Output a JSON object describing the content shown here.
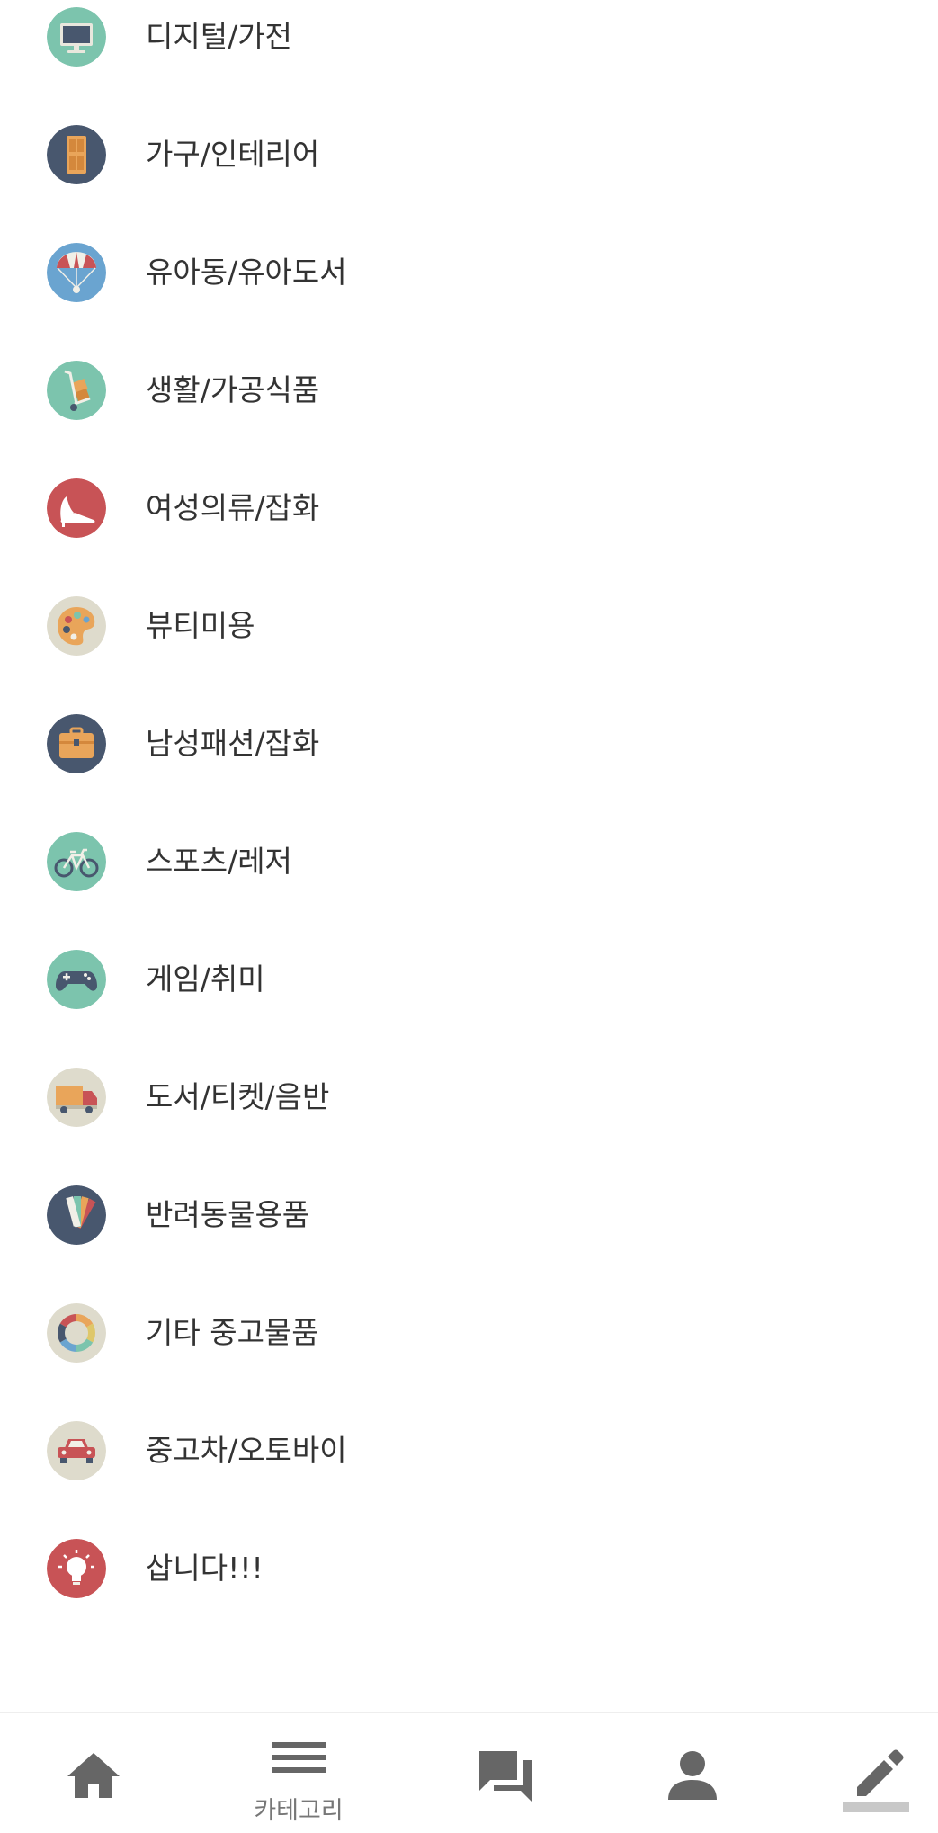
{
  "categories": [
    {
      "label": "디지털/가전",
      "icon": "monitor-icon",
      "color": "#7cc4ad"
    },
    {
      "label": "가구/인테리어",
      "icon": "door-icon",
      "color": "#48576e"
    },
    {
      "label": "유아동/유아도서",
      "icon": "parachute-icon",
      "color": "#6aa4d0"
    },
    {
      "label": "생활/가공식품",
      "icon": "hand-truck-icon",
      "color": "#7cc4ad"
    },
    {
      "label": "여성의류/잡화",
      "icon": "high-heel-icon",
      "color": "#c85356"
    },
    {
      "label": "뷰티미용",
      "icon": "palette-icon",
      "color": "#dedbcc"
    },
    {
      "label": "남성패션/잡화",
      "icon": "briefcase-icon",
      "color": "#48576e"
    },
    {
      "label": "스포츠/레저",
      "icon": "bicycle-icon",
      "color": "#7cc4ad"
    },
    {
      "label": "게임/취미",
      "icon": "gamepad-icon",
      "color": "#7cc4ad"
    },
    {
      "label": "도서/티켓/음반",
      "icon": "truck-icon",
      "color": "#dedbcc"
    },
    {
      "label": "반려동물용품",
      "icon": "color-swatch-icon",
      "color": "#48576e"
    },
    {
      "label": "기타 중고물품",
      "icon": "color-wheel-icon",
      "color": "#dedbcc"
    },
    {
      "label": "중고차/오토바이",
      "icon": "car-icon",
      "color": "#dedbcc"
    },
    {
      "label": "삽니다!!!",
      "icon": "lightbulb-icon",
      "color": "#c85356"
    }
  ],
  "bottom_nav": {
    "home": {
      "icon": "home-icon"
    },
    "category": {
      "icon": "menu-icon",
      "label": "카테고리"
    },
    "chat": {
      "icon": "chat-icon"
    },
    "profile": {
      "icon": "person-icon"
    },
    "write": {
      "icon": "pencil-icon"
    }
  },
  "colors": {
    "nav_icon": "#666666",
    "text": "#333333",
    "nav_label": "#777777"
  }
}
